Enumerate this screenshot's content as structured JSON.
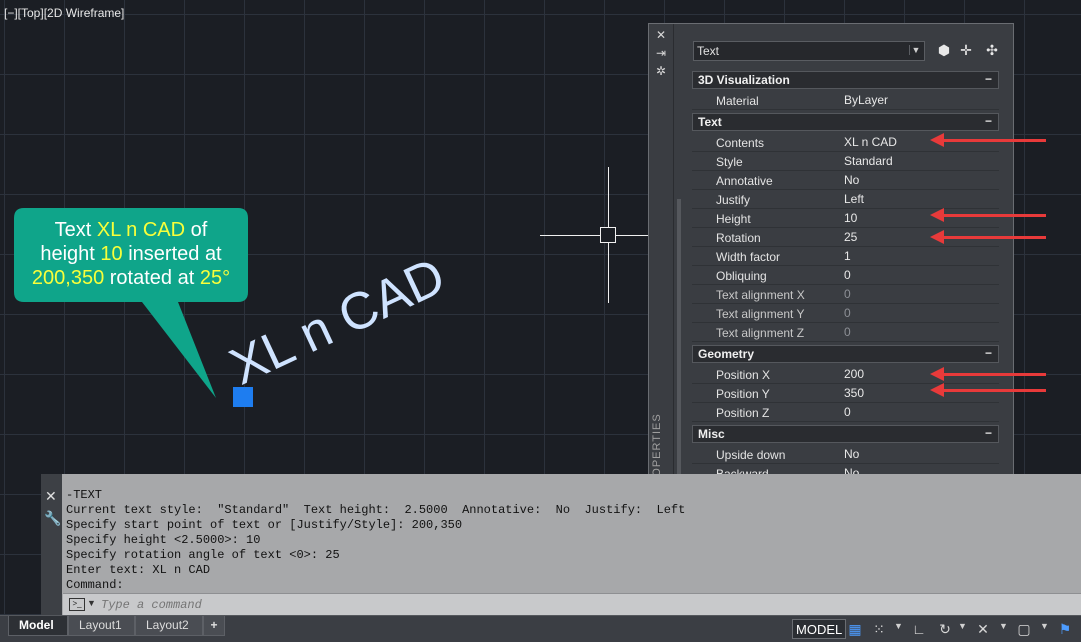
{
  "viewport": {
    "label": "[−][Top][2D Wireframe]"
  },
  "drawing": {
    "text": "XL n CAD"
  },
  "callout": {
    "parts": [
      "Text ",
      "XL n CAD",
      " of",
      "height ",
      "10",
      " inserted at",
      "200,350",
      " rotated at ",
      "25°"
    ],
    "fill": "#0fa58a",
    "highlight_color": "#f8ff3a"
  },
  "properties": {
    "selection": "Text",
    "side_title": "PROPERTIES",
    "groups": [
      {
        "title": "3D Visualization",
        "collapse": "−",
        "rows": [
          {
            "name": "Material",
            "value": "ByLayer"
          }
        ]
      },
      {
        "title": "Text",
        "collapse": "−",
        "rows": [
          {
            "name": "Contents",
            "value": "XL n CAD"
          },
          {
            "name": "Style",
            "value": "Standard"
          },
          {
            "name": "Annotative",
            "value": "No"
          },
          {
            "name": "Justify",
            "value": "Left"
          },
          {
            "name": "Height",
            "value": "10"
          },
          {
            "name": "Rotation",
            "value": "25"
          },
          {
            "name": "Width factor",
            "value": "1"
          },
          {
            "name": "Obliquing",
            "value": "0"
          },
          {
            "name": "Text alignment X",
            "value": "0"
          },
          {
            "name": "Text alignment Y",
            "value": "0"
          },
          {
            "name": "Text alignment Z",
            "value": "0"
          }
        ]
      },
      {
        "title": "Geometry",
        "collapse": "−",
        "rows": [
          {
            "name": "Position X",
            "value": "200"
          },
          {
            "name": "Position Y",
            "value": "350"
          },
          {
            "name": "Position Z",
            "value": "0"
          }
        ]
      },
      {
        "title": "Misc",
        "collapse": "−",
        "rows": [
          {
            "name": "Upside down",
            "value": "No"
          },
          {
            "name": "Backward",
            "value": "No"
          }
        ]
      }
    ]
  },
  "command_line": {
    "history": [
      "-TEXT",
      "Current text style:  \"Standard\"  Text height:  2.5000  Annotative:  No  Justify:  Left",
      "Specify start point of text or [Justify/Style]: 200,350",
      "Specify height <2.5000>: 10",
      "Specify rotation angle of text <0>: 25",
      "Enter text: XL n CAD",
      "Command:"
    ],
    "placeholder": "Type a command"
  },
  "status_bar": {
    "tabs": [
      "Model",
      "Layout1",
      "Layout2"
    ],
    "add_tab": "+",
    "model_button": "MODEL"
  },
  "colors": {
    "arrow": "#e83a3a",
    "grip": "#1e7df0",
    "accent": "#f8ff3a"
  }
}
